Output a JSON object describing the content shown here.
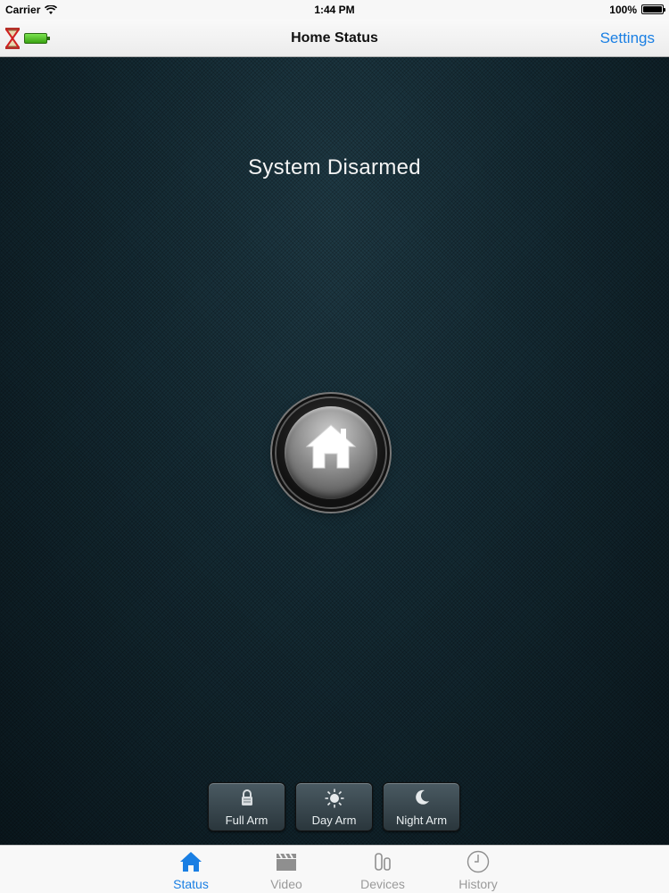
{
  "status_bar": {
    "carrier": "Carrier",
    "time": "1:44 PM",
    "battery_percent": "100%"
  },
  "nav": {
    "title": "Home Status",
    "settings_label": "Settings"
  },
  "main": {
    "system_status": "System Disarmed",
    "arm_buttons": [
      {
        "label": "Full Arm",
        "icon": "lock-icon"
      },
      {
        "label": "Day Arm",
        "icon": "sun-icon"
      },
      {
        "label": "Night Arm",
        "icon": "moon-icon"
      }
    ]
  },
  "tab_bar": {
    "active_tab": "Status",
    "accent_color": "#1a7fe3",
    "tabs": [
      {
        "label": "Status",
        "icon": "home-icon"
      },
      {
        "label": "Video",
        "icon": "clapperboard-icon"
      },
      {
        "label": "Devices",
        "icon": "sensor-icon"
      },
      {
        "label": "History",
        "icon": "clock-icon"
      }
    ]
  }
}
